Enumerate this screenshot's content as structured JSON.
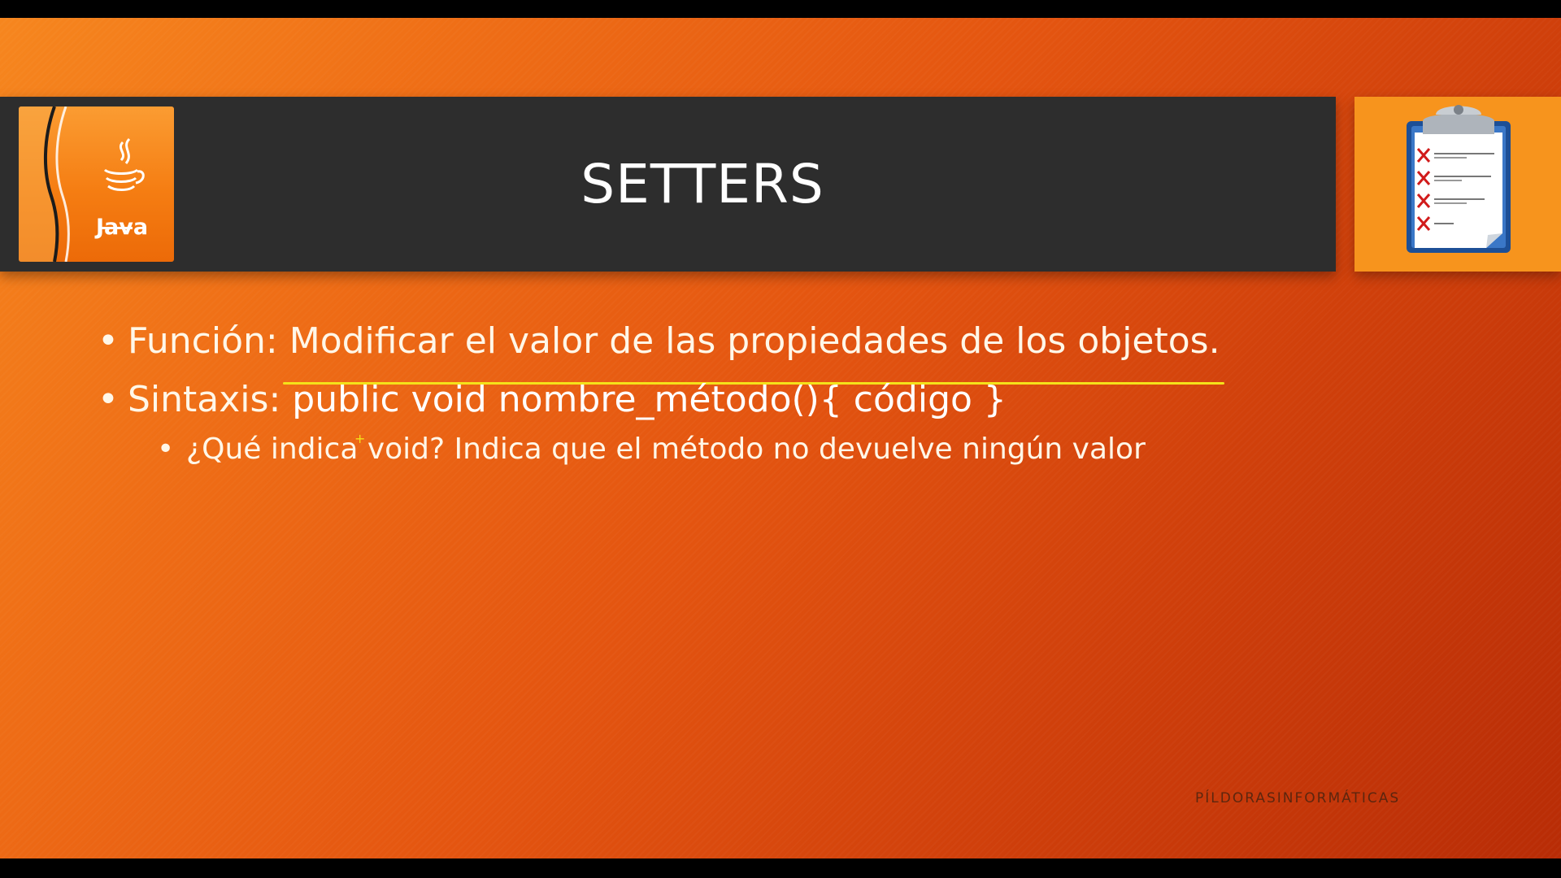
{
  "slide": {
    "title": "SETTERS",
    "logo_text": "Java",
    "bullets": [
      {
        "label": "Función:",
        "text": "Modificar el valor de las propiedades de los objetos."
      },
      {
        "label": "Sintaxis:",
        "text": "public void nombre_método(){ código }"
      }
    ],
    "sub_bullet": {
      "text": "¿Qué indica void? Indica que el método no devuelve ningún valor"
    },
    "watermark": "PÍLDORASINFORMÁTICAS"
  },
  "icons": {
    "logo": "java-logo-icon",
    "clipboard": "clipboard-checklist-icon",
    "bullet": "bullet-dot-icon",
    "cursor": "cursor-plus-icon"
  },
  "colors": {
    "title_bar": "#2d2d2d",
    "accent_orange": "#f7941d",
    "highlight_yellow": "#f4e21a",
    "text": "#ffffff"
  }
}
